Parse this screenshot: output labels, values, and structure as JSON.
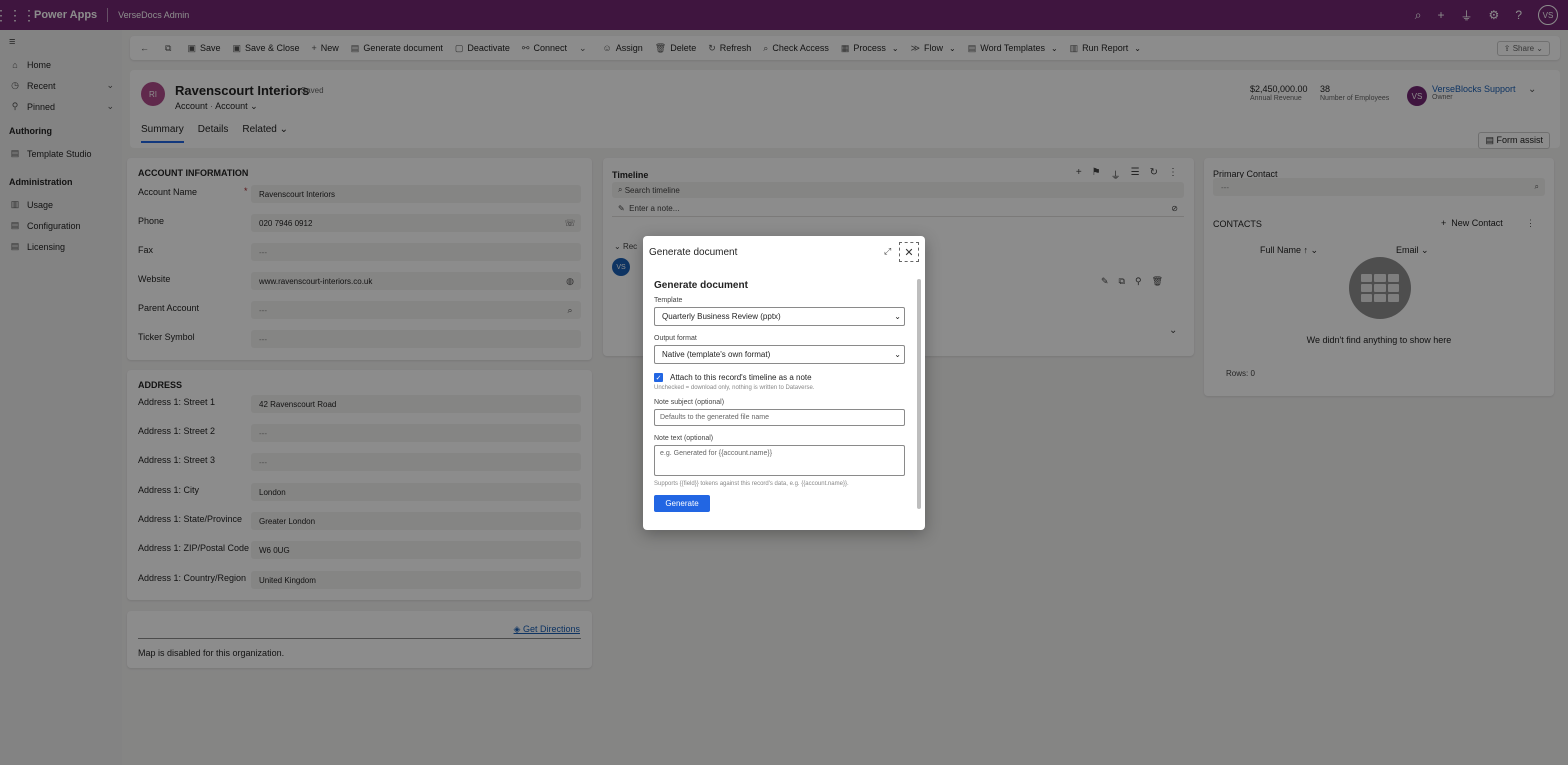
{
  "topbar": {
    "brand": "Power Apps",
    "env": "VerseDocs Admin",
    "user_initials": "VS"
  },
  "sidebar": {
    "items": [
      {
        "label": "Home",
        "icon": "home-icon"
      },
      {
        "label": "Recent",
        "icon": "clock-icon"
      },
      {
        "label": "Pinned",
        "icon": "pin-icon"
      }
    ],
    "authoring_header": "Authoring",
    "authoring_items": [
      {
        "label": "Template Studio"
      }
    ],
    "admin_header": "Administration",
    "admin_items": [
      {
        "label": "Usage"
      },
      {
        "label": "Configuration"
      },
      {
        "label": "Licensing"
      }
    ]
  },
  "commands": {
    "save": "Save",
    "save_close": "Save & Close",
    "new": "New",
    "generate": "Generate document",
    "deactivate": "Deactivate",
    "connect": "Connect",
    "assign": "Assign",
    "delete": "Delete",
    "refresh": "Refresh",
    "check_access": "Check Access",
    "process": "Process",
    "flow": "Flow",
    "word_templates": "Word Templates",
    "run_report": "Run Report",
    "share": "Share"
  },
  "record": {
    "initials": "RI",
    "name": "Ravenscourt Interiors",
    "saved": "- Saved",
    "entity": "Account",
    "form": "Account",
    "revenue": "$2,450,000.00",
    "revenue_label": "Annual Revenue",
    "employees": "38",
    "employees_label": "Number of Employees",
    "owner": "VerseBlocks Support",
    "owner_label": "Owner",
    "owner_initials": "VS"
  },
  "tabs": {
    "summary": "Summary",
    "details": "Details",
    "related": "Related",
    "form_assist": "Form assist"
  },
  "account_info": {
    "title": "ACCOUNT INFORMATION",
    "fields": [
      {
        "label": "Account Name",
        "value": "Ravenscourt Interiors"
      },
      {
        "label": "Phone",
        "value": "020 7946 0912"
      },
      {
        "label": "Fax",
        "value": "---"
      },
      {
        "label": "Website",
        "value": "www.ravenscourt-interiors.co.uk"
      },
      {
        "label": "Parent Account",
        "value": "---"
      },
      {
        "label": "Ticker Symbol",
        "value": "---"
      }
    ]
  },
  "address": {
    "title": "ADDRESS",
    "fields": [
      {
        "label": "Address 1: Street 1",
        "value": "42 Ravenscourt Road"
      },
      {
        "label": "Address 1: Street 2",
        "value": "---"
      },
      {
        "label": "Address 1: Street 3",
        "value": "---"
      },
      {
        "label": "Address 1: City",
        "value": "London"
      },
      {
        "label": "Address 1: State/Province",
        "value": "Greater London"
      },
      {
        "label": "Address 1: ZIP/Postal Code",
        "value": "W6 0UG"
      },
      {
        "label": "Address 1: Country/Region",
        "value": "United Kingdom"
      }
    ]
  },
  "map": {
    "directions": "Get Directions",
    "disabled": "Map is disabled for this organization."
  },
  "timeline": {
    "title": "Timeline",
    "search": "Search timeline",
    "note": "Enter a note...",
    "recent_prefix": "Rec",
    "avatar": "VS"
  },
  "contacts": {
    "primary_label": "Primary Contact",
    "primary_value": "---",
    "title": "CONTACTS",
    "new_contact": "New Contact",
    "col_name": "Full Name ↑",
    "col_email": "Email",
    "empty": "We didn't find anything to show here",
    "rows": "Rows: 0"
  },
  "dialog": {
    "header": "Generate document",
    "title": "Generate document",
    "template_label": "Template",
    "template_value": "Quarterly Business Review (pptx)",
    "format_label": "Output format",
    "format_value": "Native (template's own format)",
    "attach_label": "Attach to this record's timeline as a note",
    "attach_checked": true,
    "attach_hint": "Unchecked = download only, nothing is written to Dataverse.",
    "subject_label": "Note subject (optional)",
    "subject_placeholder": "Defaults to the generated file name",
    "text_label": "Note text (optional)",
    "text_placeholder": "e.g. Generated for {{account.name}}",
    "tokens_hint": "Supports {{field}} tokens against this record's data, e.g. {{account.name}}.",
    "generate": "Generate"
  }
}
